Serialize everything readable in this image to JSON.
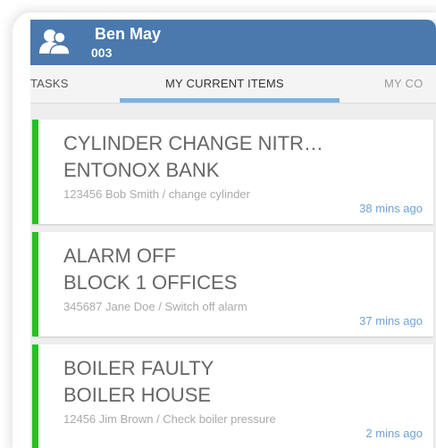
{
  "header": {
    "user_name": "Ben May",
    "user_id": "003"
  },
  "tabs": [
    {
      "label": "TASKS"
    },
    {
      "label": "MY CURRENT ITEMS",
      "selected": true
    },
    {
      "label": "MY CO"
    }
  ],
  "items": [
    {
      "title_line1": "CYLINDER CHANGE NITR…",
      "title_line2": "ENTONOX BANK",
      "detail": "123456 Bob Smith / change cylinder",
      "time": "38 mins ago"
    },
    {
      "title_line1": "ALARM OFF",
      "title_line2": "BLOCK 1 OFFICES",
      "detail": "345687 Jane Doe / Switch off alarm",
      "time": "37 mins ago"
    },
    {
      "title_line1": "BOILER FAULTY",
      "title_line2": "BOILER HOUSE",
      "detail": "12456 Jim Brown / Check boiler pressure",
      "time": "2 mins ago"
    }
  ],
  "colors": {
    "appbar": "#4a79ae",
    "tab_indicator": "#7fb0de",
    "status_bar": "#22c322",
    "time_text": "#6fa2d6"
  },
  "icons": {
    "avatar": "users-group-icon"
  }
}
